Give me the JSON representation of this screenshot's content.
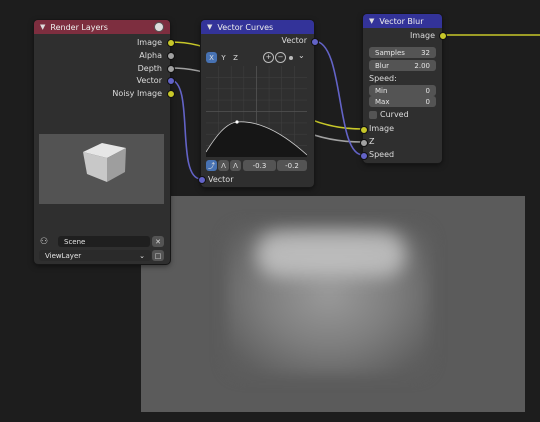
{
  "render_layers": {
    "title": "Render Layers",
    "outputs": [
      "Image",
      "Alpha",
      "Depth",
      "Vector",
      "Noisy Image"
    ],
    "scene": "Scene",
    "view_layer": "ViewLayer"
  },
  "vector_curves": {
    "title": "Vector Curves",
    "output": "Vector",
    "tabs": [
      "X",
      "Y",
      "Z"
    ],
    "min_value": "-0.3",
    "max_value": "-0.2",
    "input": "Vector"
  },
  "vector_blur": {
    "title": "Vector Blur",
    "output": "Image",
    "samples_label": "Samples",
    "samples_value": "32",
    "blur_label": "Blur",
    "blur_value": "2.00",
    "speed_label": "Speed:",
    "min_label": "Min",
    "min_value": "0",
    "max_label": "Max",
    "max_value": "0",
    "curved_label": "Curved",
    "inputs": [
      "Image",
      "Z",
      "Speed"
    ]
  },
  "colors": {
    "render_layers_header": "#7d2e3f",
    "vector_header": "#333399",
    "socket_color": "#c7c729",
    "socket_value": "#a1a1a1",
    "socket_vector": "#6363c7"
  }
}
